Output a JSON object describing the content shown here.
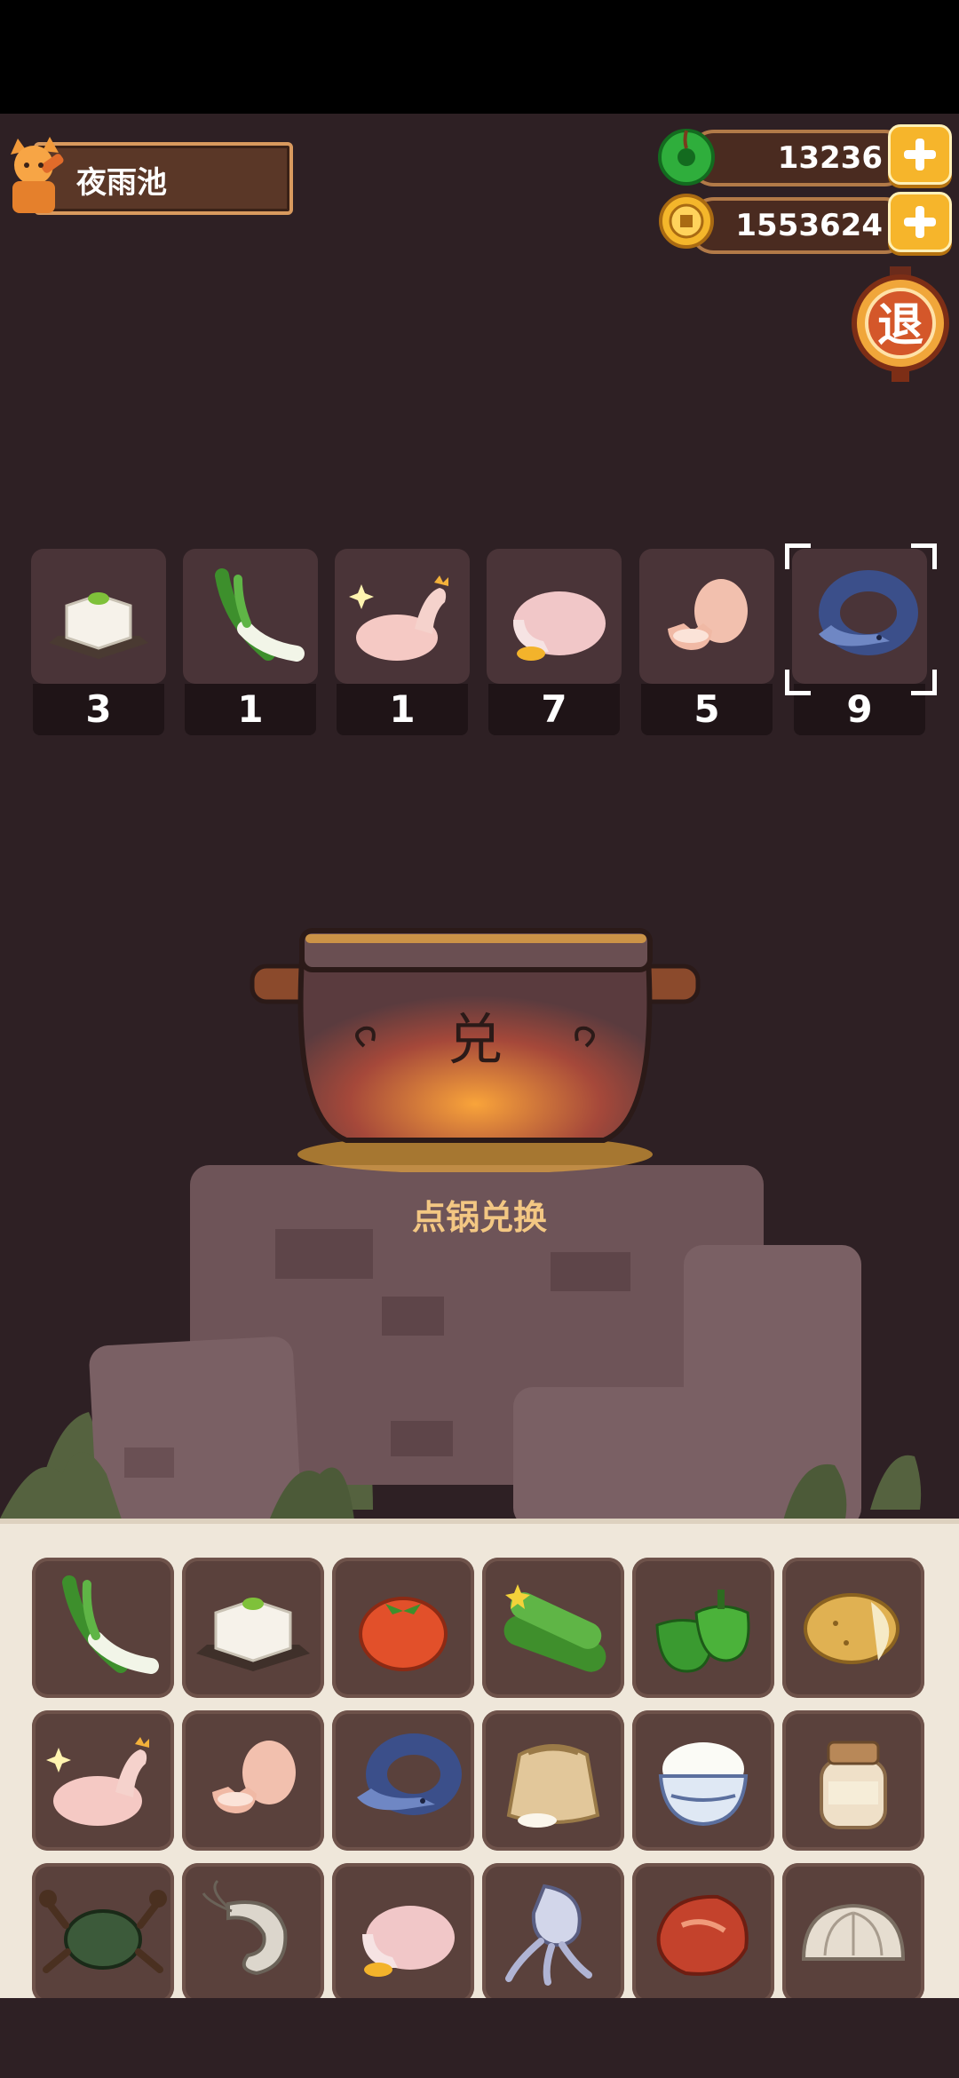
{
  "player": {
    "name": "夜雨池",
    "avatar_icon": "fox-avatar-icon"
  },
  "currency": {
    "jade": {
      "value": "13236",
      "icon": "jade-icon"
    },
    "coins": {
      "value": "1553624",
      "icon": "coin-icon"
    }
  },
  "exit_button": {
    "label": "退"
  },
  "selected_ingredients": [
    {
      "icon": "tofu-icon",
      "count": "3"
    },
    {
      "icon": "leek-icon",
      "count": "1"
    },
    {
      "icon": "chicken-icon",
      "count": "1"
    },
    {
      "icon": "duck-icon",
      "count": "7"
    },
    {
      "icon": "egg-icon",
      "count": "5"
    },
    {
      "icon": "eel-icon",
      "count": "9"
    }
  ],
  "pot": {
    "glyph": "兑",
    "action_label": "点锅兑换"
  },
  "inventory": [
    {
      "icon": "leek-icon"
    },
    {
      "icon": "tofu-icon"
    },
    {
      "icon": "tomato-icon"
    },
    {
      "icon": "cucumber-icon"
    },
    {
      "icon": "green-pepper-icon"
    },
    {
      "icon": "potato-icon"
    },
    {
      "icon": "chicken-icon"
    },
    {
      "icon": "egg-icon"
    },
    {
      "icon": "eel-icon"
    },
    {
      "icon": "flour-sack-icon"
    },
    {
      "icon": "rice-bowl-icon"
    },
    {
      "icon": "jar-icon"
    },
    {
      "icon": "crab-icon"
    },
    {
      "icon": "shrimp-icon"
    },
    {
      "icon": "duck-icon"
    },
    {
      "icon": "squid-icon"
    },
    {
      "icon": "meat-icon"
    },
    {
      "icon": "clam-icon"
    }
  ]
}
